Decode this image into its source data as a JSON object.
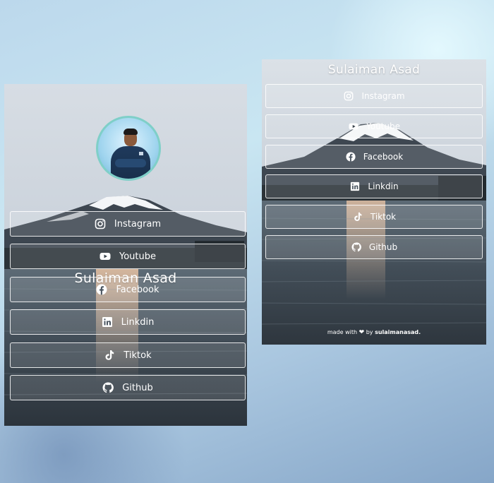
{
  "profile": {
    "name": "Sulaiman Asad"
  },
  "links": [
    {
      "label": "Instagram",
      "icon": "instagram-icon"
    },
    {
      "label": "Youtube",
      "icon": "youtube-icon"
    },
    {
      "label": "Facebook",
      "icon": "facebook-icon"
    },
    {
      "label": "Linkdin",
      "icon": "linkedin-icon"
    },
    {
      "label": "Tiktok",
      "icon": "tiktok-icon"
    },
    {
      "label": "Github",
      "icon": "github-icon"
    }
  ],
  "footer": {
    "prefix": "made with",
    "middle": "by",
    "author": "sulaimanasad."
  }
}
